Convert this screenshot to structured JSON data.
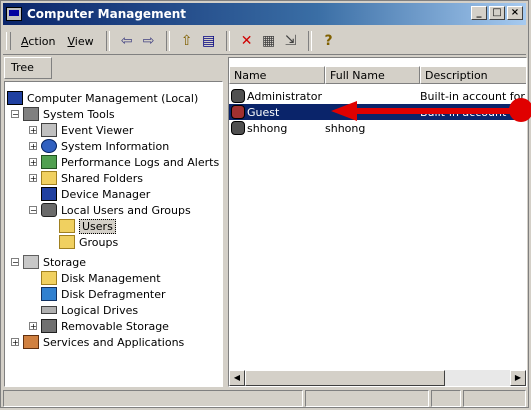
{
  "window": {
    "title": "Computer Management"
  },
  "title_buttons": [
    "_",
    "□",
    "×"
  ],
  "menu": [
    {
      "accel": "A",
      "rest": "ction"
    },
    {
      "accel": "V",
      "rest": "iew"
    }
  ],
  "toolbar_icons": [
    "back-icon",
    "forward-icon",
    "up-folder-icon",
    "show-hide-tree-icon",
    "delete-icon",
    "properties-icon",
    "export-list-icon",
    "help-icon"
  ],
  "toolbar_glyphs": {
    "back": "⇦",
    "forward": "⇨",
    "up": "⇧",
    "tree": "▤",
    "delete": "✕",
    "properties": "▦",
    "export": "⇲",
    "help": "?"
  },
  "tree": {
    "header": "Tree",
    "nodes": [
      {
        "label": "Computer Management (Local)",
        "icon": "computer-icon"
      },
      {
        "label": "System Tools",
        "icon": "tools-icon"
      },
      {
        "label": "Event Viewer",
        "icon": "event-viewer-icon"
      },
      {
        "label": "System Information",
        "icon": "info-icon"
      },
      {
        "label": "Performance Logs and Alerts",
        "icon": "performance-icon"
      },
      {
        "label": "Shared Folders",
        "icon": "folder-icon"
      },
      {
        "label": "Device Manager",
        "icon": "device-manager-icon"
      },
      {
        "label": "Local Users and Groups",
        "icon": "users-group-icon"
      },
      {
        "label": "Users",
        "icon": "folder-icon"
      },
      {
        "label": "Groups",
        "icon": "folder-icon"
      },
      {
        "label": "Storage",
        "icon": "storage-icon"
      },
      {
        "label": "Disk Management",
        "icon": "disk-icon"
      },
      {
        "label": "Disk Defragmenter",
        "icon": "defrag-icon"
      },
      {
        "label": "Logical Drives",
        "icon": "drive-icon"
      },
      {
        "label": "Removable Storage",
        "icon": "removable-icon"
      },
      {
        "label": "Services and Applications",
        "icon": "services-icon"
      }
    ]
  },
  "list": {
    "columns": [
      "Name",
      "Full Name",
      "Description"
    ],
    "rows": [
      {
        "name": "Administrator",
        "full_name": "",
        "description": "Built-in account for ad"
      },
      {
        "name": "Guest",
        "full_name": "",
        "description": "Built-in account for gu"
      },
      {
        "name": "shhong",
        "full_name": "shhong",
        "description": ""
      }
    ]
  },
  "annotation": {
    "color": "#e00000"
  }
}
